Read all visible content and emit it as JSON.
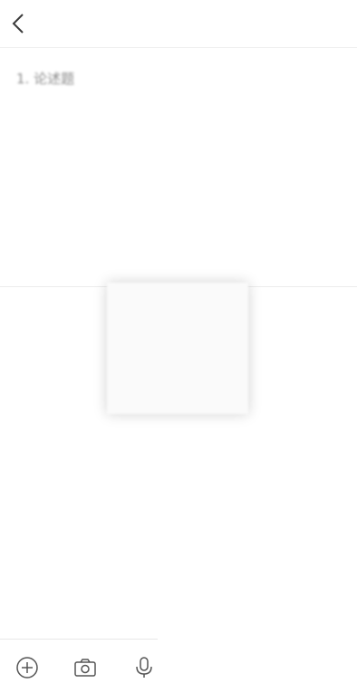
{
  "header": {
    "back_icon": "chevron-left-icon",
    "title_line1": "",
    "title_line2": ""
  },
  "question": {
    "number_label": "1. 论述题",
    "text": ""
  },
  "answer": {
    "items": [
      "",
      ""
    ]
  },
  "toolbar": {
    "icons": [
      "add-circle-icon",
      "camera-icon",
      "microphone-icon"
    ]
  }
}
